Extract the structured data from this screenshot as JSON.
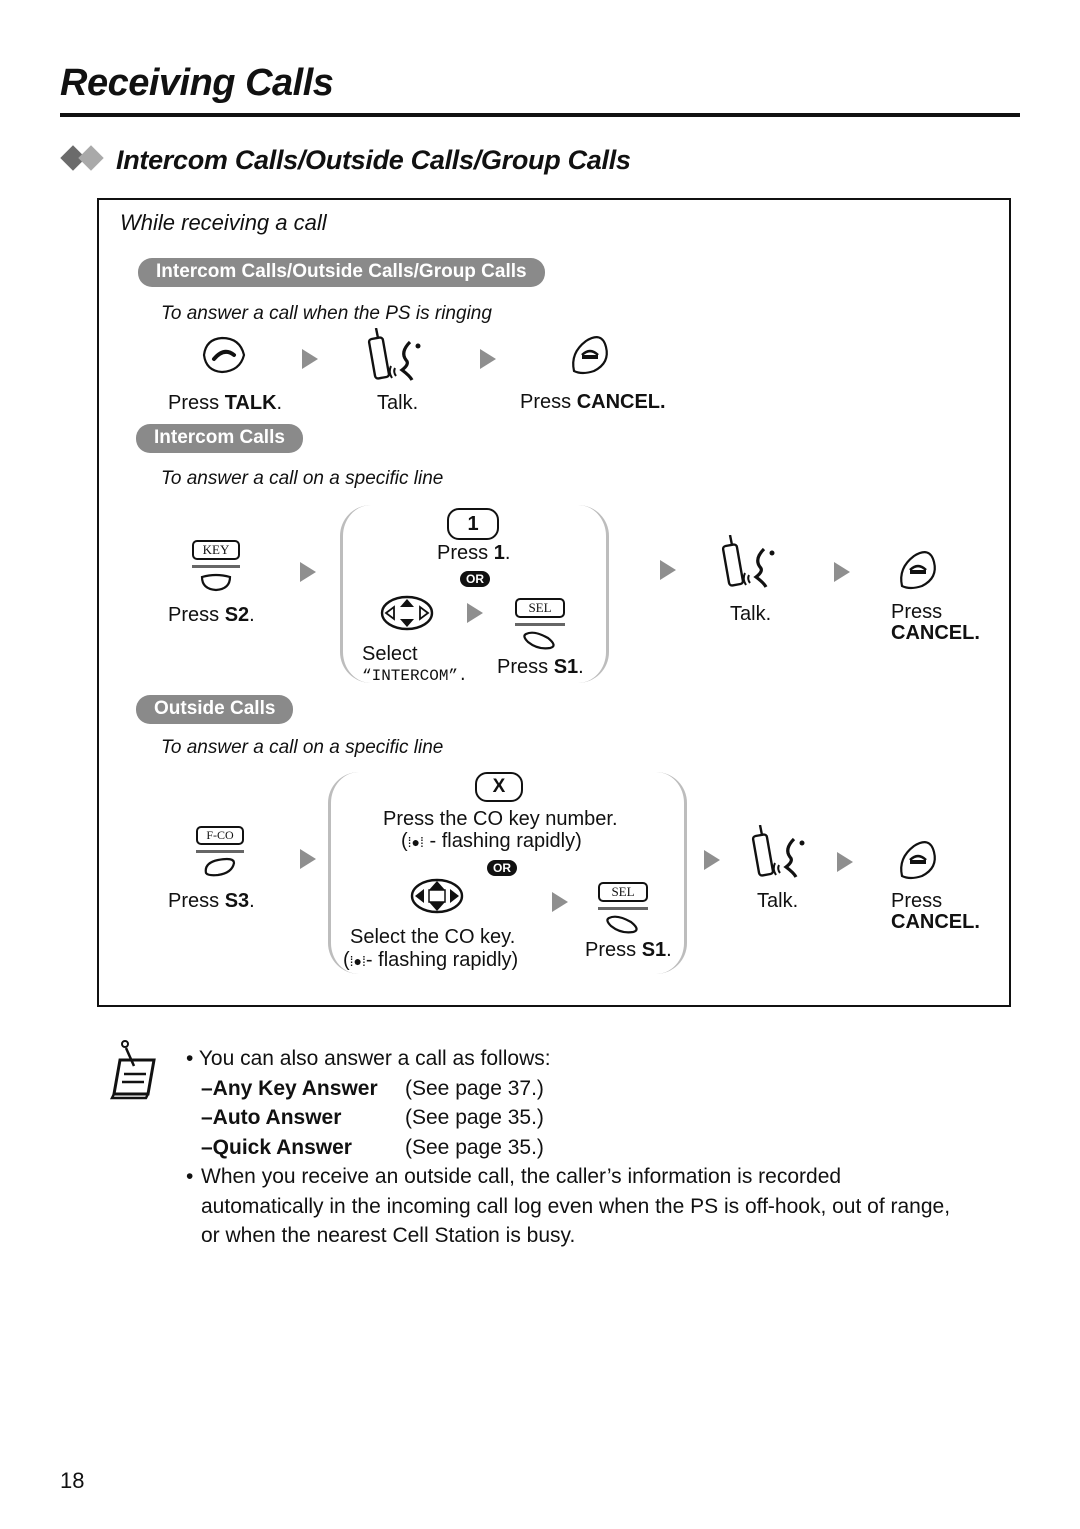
{
  "page": {
    "title": "Receiving Calls",
    "section_title": "Intercom Calls/Outside Calls/Group Calls",
    "page_number": "18"
  },
  "box": {
    "subtitle": "While receiving a call",
    "group1": {
      "pill": "Intercom Calls/Outside Calls/Group Calls",
      "hint": "To answer a call when the PS is ringing",
      "step1": {
        "prefix": "Press ",
        "key": "TALK",
        "suffix": "."
      },
      "step2": {
        "label": "Talk."
      },
      "step3": {
        "prefix": "Press ",
        "key": "CANCEL",
        "suffix": "."
      }
    },
    "group2": {
      "pill": "Intercom Calls",
      "hint": "To answer a call on a specific line",
      "step1": {
        "key_label": "KEY",
        "prefix": "Press ",
        "key": "S2",
        "suffix": "."
      },
      "option_a": {
        "button": "1",
        "prefix": "Press ",
        "key": "1",
        "suffix": "."
      },
      "or": "OR",
      "option_b": {
        "select_line1": "Select",
        "select_line2": "“INTERCOM”.",
        "sel_label": "SEL",
        "prefix": "Press ",
        "key": "S1",
        "suffix": "."
      },
      "talk": "Talk.",
      "cancel": {
        "prefix": "Press",
        "key": "CANCEL."
      }
    },
    "group3": {
      "pill": "Outside Calls",
      "hint": "To answer a call on a specific line",
      "step1": {
        "key_label": "F-CO",
        "prefix": "Press ",
        "key": "S3",
        "suffix": "."
      },
      "option_a": {
        "button": "X",
        "line1": "Press the CO key number.",
        "line2": "- flashing rapidly)"
      },
      "or": "OR",
      "option_b": {
        "line1": "Select the CO key.",
        "line2": "- flashing rapidly)",
        "sel_label": "SEL",
        "prefix": "Press ",
        "key": "S1",
        "suffix": "."
      },
      "talk": "Talk.",
      "cancel": {
        "prefix": "Press",
        "key": "CANCEL."
      }
    }
  },
  "notes": {
    "intro": "You can also answer a call as follows:",
    "items": [
      {
        "label": "–Any Key Answer",
        "ref": "(See page 37.)"
      },
      {
        "label": "–Auto Answer",
        "ref": "(See page 35.)"
      },
      {
        "label": "–Quick Answer",
        "ref": "(See page 35.)"
      }
    ],
    "second": "When you receive an outside call, the caller’s information is recorded automatically in the incoming call log even when the PS is off-hook, out of range, or when the nearest Cell Station is busy."
  }
}
